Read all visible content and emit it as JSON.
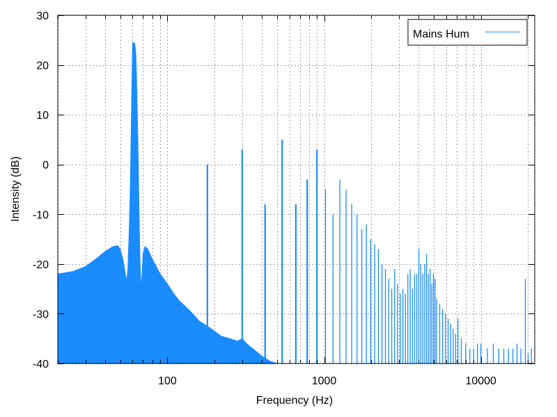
{
  "chart_data": {
    "type": "area",
    "xscale": "log",
    "xlabel": "Frequency (Hz)",
    "ylabel": "Intensity (dB)",
    "xlim": [
      20,
      22050
    ],
    "ylim": [
      -40,
      30
    ],
    "grid": true,
    "legend_position": "top-right",
    "x_ticks": [
      {
        "value": 100,
        "label": "100"
      },
      {
        "value": 1000,
        "label": "1000"
      },
      {
        "value": 10000,
        "label": "10000"
      }
    ],
    "y_ticks": [
      {
        "value": 30,
        "label": "30"
      },
      {
        "value": 20,
        "label": "20"
      },
      {
        "value": 10,
        "label": "10"
      },
      {
        "value": 0,
        "label": "0"
      },
      {
        "value": -10,
        "label": "-10"
      },
      {
        "value": -20,
        "label": "-20"
      },
      {
        "value": -30,
        "label": "-30"
      },
      {
        "value": -40,
        "label": "-40"
      }
    ],
    "series": [
      {
        "name": "Mains Hum",
        "color": "#1a8cff",
        "floor_points": [
          [
            20,
            -22
          ],
          [
            25,
            -21.5
          ],
          [
            30,
            -20.5
          ],
          [
            35,
            -19
          ],
          [
            40,
            -17.5
          ],
          [
            45,
            -16.5
          ],
          [
            48,
            -16.3
          ],
          [
            50,
            -17
          ],
          [
            52,
            -19
          ],
          [
            54,
            -22
          ],
          [
            55,
            -23.5
          ],
          [
            56,
            -21
          ],
          [
            57,
            -14
          ],
          [
            58,
            -5
          ],
          [
            59,
            10
          ],
          [
            60,
            24.5
          ],
          [
            61,
            24.5
          ],
          [
            62,
            24.3
          ],
          [
            63,
            22
          ],
          [
            64,
            14
          ],
          [
            65,
            3
          ],
          [
            66,
            -10
          ],
          [
            67,
            -20
          ],
          [
            68,
            -25
          ],
          [
            69,
            -22
          ],
          [
            70,
            -18
          ],
          [
            72,
            -16.5
          ],
          [
            75,
            -17
          ],
          [
            80,
            -19
          ],
          [
            90,
            -22
          ],
          [
            100,
            -24
          ],
          [
            110,
            -26
          ],
          [
            120,
            -27.5
          ],
          [
            130,
            -28.5
          ],
          [
            140,
            -29.5
          ],
          [
            150,
            -30.5
          ],
          [
            160,
            -31.5
          ],
          [
            170,
            -32
          ],
          [
            180,
            -32.5
          ],
          [
            200,
            -33.5
          ],
          [
            220,
            -34.5
          ],
          [
            250,
            -35
          ],
          [
            280,
            -35.5
          ],
          [
            300,
            -35
          ],
          [
            320,
            -36
          ],
          [
            350,
            -37
          ],
          [
            400,
            -38.5
          ],
          [
            450,
            -39.5
          ],
          [
            500,
            -40
          ],
          [
            22050,
            -40
          ]
        ],
        "peaks": [
          [
            180,
            0
          ],
          [
            300,
            3
          ],
          [
            420,
            -8
          ],
          [
            540,
            5
          ],
          [
            660,
            -8
          ],
          [
            780,
            -3
          ],
          [
            900,
            3
          ],
          [
            1020,
            -5
          ],
          [
            1140,
            -10
          ],
          [
            1260,
            -3
          ],
          [
            1380,
            -5
          ],
          [
            1500,
            -8
          ],
          [
            1620,
            -10
          ],
          [
            1740,
            -13
          ],
          [
            1860,
            -12
          ],
          [
            1980,
            -15
          ],
          [
            2100,
            -16
          ],
          [
            2220,
            -17
          ],
          [
            2340,
            -20
          ],
          [
            2460,
            -21
          ],
          [
            2580,
            -23
          ],
          [
            2700,
            -25
          ],
          [
            2820,
            -21
          ],
          [
            2940,
            -24
          ],
          [
            3060,
            -26
          ],
          [
            3180,
            -25
          ],
          [
            3300,
            -26
          ],
          [
            3420,
            -22
          ],
          [
            3540,
            -21
          ],
          [
            3660,
            -25
          ],
          [
            3780,
            -22
          ],
          [
            3900,
            -22
          ],
          [
            4020,
            -17
          ],
          [
            4140,
            -20
          ],
          [
            4260,
            -22
          ],
          [
            4380,
            -20
          ],
          [
            4500,
            -18
          ],
          [
            4620,
            -22
          ],
          [
            4740,
            -21
          ],
          [
            4860,
            -24
          ],
          [
            4980,
            -22
          ],
          [
            5100,
            -23
          ],
          [
            5220,
            -27
          ],
          [
            5460,
            -28
          ],
          [
            5700,
            -29
          ],
          [
            5940,
            -30
          ],
          [
            6180,
            -31
          ],
          [
            6420,
            -32
          ],
          [
            6660,
            -33
          ],
          [
            6900,
            -34
          ],
          [
            7140,
            -31
          ],
          [
            7500,
            -35
          ],
          [
            8000,
            -36
          ],
          [
            8500,
            -37
          ],
          [
            9000,
            -37
          ],
          [
            9500,
            -36
          ],
          [
            10000,
            -36
          ],
          [
            11000,
            -37
          ],
          [
            12000,
            -36
          ],
          [
            13000,
            -37
          ],
          [
            14000,
            -37
          ],
          [
            15000,
            -37
          ],
          [
            16000,
            -37
          ],
          [
            17000,
            -36
          ],
          [
            18000,
            -37
          ],
          [
            19200,
            -23
          ],
          [
            20000,
            -38
          ],
          [
            21000,
            -37
          ]
        ]
      }
    ]
  }
}
